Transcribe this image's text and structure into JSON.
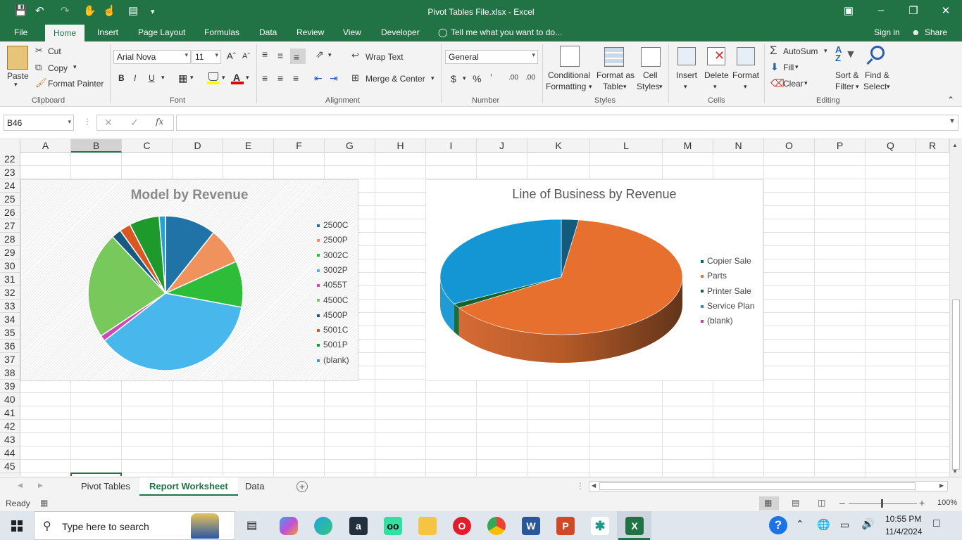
{
  "window": {
    "title": "Pivot Tables File.xlsx - Excel"
  },
  "menu": {
    "tabs": [
      "File",
      "Home",
      "Insert",
      "Page Layout",
      "Formulas",
      "Data",
      "Review",
      "View",
      "Developer"
    ],
    "tell_me": "Tell me what you want to do...",
    "sign_in": "Sign in",
    "share": "Share"
  },
  "ribbon": {
    "clipboard": {
      "paste": "Paste",
      "cut": "Cut",
      "copy": "Copy",
      "format_painter": "Format Painter",
      "group": "Clipboard"
    },
    "font": {
      "name": "Arial Nova",
      "size": "11",
      "group": "Font"
    },
    "alignment": {
      "wrap_text": "Wrap Text",
      "merge_center": "Merge & Center",
      "group": "Alignment"
    },
    "number": {
      "format": "General",
      "group": "Number"
    },
    "styles": {
      "conditional": "Conditional",
      "conditional2": "Formatting",
      "format_as": "Format as",
      "format_as2": "Table",
      "cell": "Cell",
      "cell2": "Styles",
      "group": "Styles"
    },
    "cells": {
      "insert": "Insert",
      "delete": "Delete",
      "format": "Format",
      "group": "Cells"
    },
    "editing": {
      "autosum": "AutoSum",
      "fill": "Fill",
      "clear": "Clear",
      "sort": "Sort &",
      "sort2": "Filter",
      "find": "Find &",
      "find2": "Select",
      "group": "Editing"
    }
  },
  "formula_bar": {
    "name_box": "B46",
    "fx": "fx",
    "value": ""
  },
  "grid": {
    "columns": [
      "A",
      "B",
      "C",
      "D",
      "E",
      "F",
      "G",
      "H",
      "I",
      "J",
      "K",
      "L",
      "M",
      "N",
      "O",
      "P",
      "Q",
      "R"
    ],
    "rows": [
      "22",
      "23",
      "24",
      "25",
      "26",
      "27",
      "28",
      "29",
      "30",
      "31",
      "32",
      "33",
      "34",
      "35",
      "36",
      "37",
      "38",
      "39",
      "40",
      "41",
      "42",
      "43",
      "44",
      "45"
    ]
  },
  "chart_data": [
    {
      "type": "pie",
      "title": "Model by Revenue",
      "categories": [
        "2500C",
        "2500P",
        "3002C",
        "3002P",
        "4055T",
        "4500C",
        "4500P",
        "5001C",
        "5001P",
        "(blank)"
      ],
      "values": [
        10.5,
        7.5,
        9.5,
        36.0,
        1.2,
        22.0,
        2.0,
        2.3,
        6.2,
        1.3
      ],
      "colors": [
        "#1f73a6",
        "#f0925e",
        "#2ebd38",
        "#47b7ec",
        "#d048b8",
        "#77c95c",
        "#165a82",
        "#d95822",
        "#1e9a2c",
        "#21a3d9"
      ],
      "legend": "right"
    },
    {
      "type": "pie",
      "title": "Line of Business by Revenue",
      "categories": [
        "Copier Sale",
        "Parts",
        "Printer Sale",
        "Service Plan",
        "(blank)"
      ],
      "values": [
        2.3,
        63.7,
        1.3,
        32.7,
        0
      ],
      "colors": [
        "#145a7c",
        "#e8702e",
        "#15632a",
        "#1496d4",
        "#c63fa8"
      ],
      "legend": "right",
      "style": "3d"
    }
  ],
  "sheets": {
    "tabs": [
      "Pivot Tables",
      "Report Worksheet",
      "Data"
    ],
    "active": "Report Worksheet"
  },
  "status": {
    "ready": "Ready",
    "zoom": "100%"
  },
  "taskbar": {
    "search_placeholder": "Type here to search",
    "time": "10:55 PM",
    "date": "11/4/2024"
  }
}
